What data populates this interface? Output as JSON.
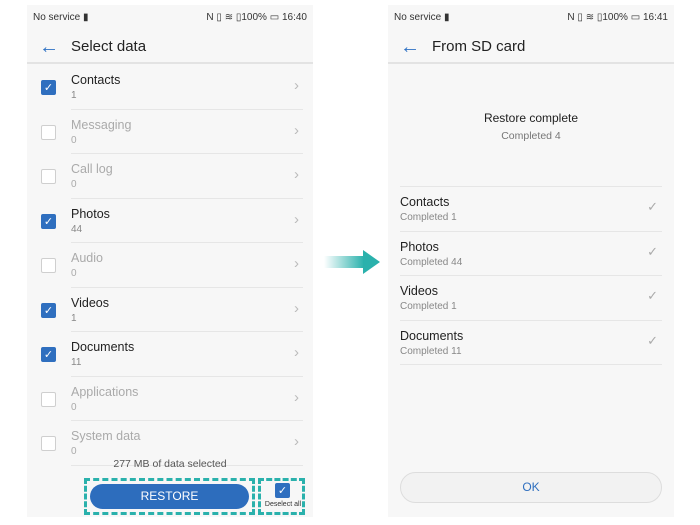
{
  "left": {
    "status": {
      "carrier": "No service",
      "battery": "100%",
      "time": "16:40"
    },
    "title": "Select data",
    "items": [
      {
        "name": "Contacts",
        "count": "1",
        "checked": true
      },
      {
        "name": "Messaging",
        "count": "0",
        "checked": false
      },
      {
        "name": "Call log",
        "count": "0",
        "checked": false
      },
      {
        "name": "Photos",
        "count": "44",
        "checked": true
      },
      {
        "name": "Audio",
        "count": "0",
        "checked": false
      },
      {
        "name": "Videos",
        "count": "1",
        "checked": true
      },
      {
        "name": "Documents",
        "count": "11",
        "checked": true
      },
      {
        "name": "Applications",
        "count": "0",
        "checked": false
      },
      {
        "name": "System data",
        "count": "0",
        "checked": false
      }
    ],
    "selected": "277 MB of data selected",
    "restore": "RESTORE",
    "deselect": "Deselect all"
  },
  "right": {
    "status": {
      "carrier": "No service",
      "battery": "100%",
      "time": "16:41"
    },
    "title": "From SD card",
    "heading": "Restore complete",
    "summary": "Completed 4",
    "items": [
      {
        "name": "Contacts",
        "status": "Completed 1"
      },
      {
        "name": "Photos",
        "status": "Completed 44"
      },
      {
        "name": "Videos",
        "status": "Completed 1"
      },
      {
        "name": "Documents",
        "status": "Completed 11"
      }
    ],
    "ok": "OK"
  },
  "colors": {
    "accent": "#2d6dbd",
    "highlight": "#2ab1ac"
  }
}
